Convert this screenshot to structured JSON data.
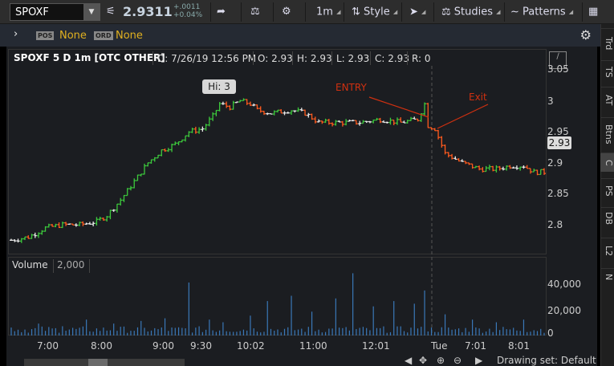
{
  "toolbar": {
    "symbol": "SPOXF",
    "last_price": "2.9311",
    "net_change": "+.0011",
    "pct_change": "+0.04%",
    "timeframe": "1m",
    "style_label": "Style",
    "studies_label": "Studies",
    "patterns_label": "Patterns"
  },
  "subbar": {
    "pos_tag": "POS",
    "pos_value": "None",
    "ord_tag": "ORD",
    "ord_value": "None"
  },
  "chart_header": {
    "symbol_desc": "SPOXF 5 D 1m [OTC OTHER]",
    "date": "D: 7/26/19 12:56 PM",
    "open": "O: 2.93",
    "high": "H: 2.93",
    "low": "L: 2.93",
    "close": "C: 2.93",
    "range": "R: 0"
  },
  "volume_header": {
    "label": "Volume",
    "value": "2,000"
  },
  "price_flag": "2.93",
  "annotations": {
    "entry": "ENTRY",
    "exit": "Exit",
    "high_bubble": "Hi: 3"
  },
  "drawing_set": "Drawing set: Default",
  "right_tabs": [
    "Trd",
    "TS",
    "AT",
    "Btns",
    "C",
    "PS",
    "DB",
    "L2",
    "N"
  ],
  "colors": {
    "up": "#3cc83c",
    "down": "#ff5a1e",
    "neutral": "#e8e8e8",
    "volume": "#3a78b8",
    "annotation": "#d03010",
    "symbol_text": "#e0b020"
  },
  "chart_data": {
    "type": "bar",
    "title": "SPOXF 5 D 1m [OTC OTHER]",
    "x_tick_labels": [
      "7:00",
      "8:00",
      "9:00",
      "9:30",
      "10:02",
      "11:00",
      "12:01",
      "Tue",
      "7:01",
      "8:01"
    ],
    "price_axis": {
      "ticks": [
        "3.05",
        "3",
        "2.95",
        "2.9",
        "2.85",
        "2.8"
      ],
      "ylim": [
        2.77,
        3.06
      ]
    },
    "volume_axis": {
      "ticks": [
        "40,000",
        "20,000",
        "0"
      ],
      "ylim": [
        0,
        48000
      ]
    },
    "price_path": [
      [
        0,
        2.775
      ],
      [
        5,
        2.78
      ],
      [
        10,
        2.795
      ],
      [
        15,
        2.8
      ],
      [
        20,
        2.8
      ],
      [
        25,
        2.805
      ],
      [
        28,
        2.815
      ],
      [
        32,
        2.84
      ],
      [
        36,
        2.87
      ],
      [
        40,
        2.9
      ],
      [
        44,
        2.92
      ],
      [
        48,
        2.93
      ],
      [
        52,
        2.95
      ],
      [
        56,
        2.955
      ],
      [
        59,
        2.975
      ],
      [
        61,
        2.995
      ],
      [
        64,
        2.99
      ],
      [
        67,
        3.0
      ],
      [
        70,
        2.995
      ],
      [
        72,
        2.985
      ],
      [
        76,
        2.98
      ],
      [
        82,
        2.985
      ],
      [
        86,
        2.98
      ],
      [
        90,
        2.965
      ],
      [
        96,
        2.965
      ],
      [
        102,
        2.965
      ],
      [
        108,
        2.97
      ],
      [
        114,
        2.965
      ],
      [
        119,
        2.97
      ],
      [
        121,
        2.995
      ],
      [
        122,
        2.96
      ],
      [
        124,
        2.955
      ],
      [
        127,
        2.915
      ],
      [
        132,
        2.9
      ],
      [
        137,
        2.89
      ],
      [
        142,
        2.89
      ],
      [
        146,
        2.895
      ],
      [
        150,
        2.895
      ],
      [
        153,
        2.885
      ],
      [
        155,
        2.885
      ]
    ],
    "volume_spikes": [
      [
        0,
        6000
      ],
      [
        8,
        9000
      ],
      [
        15,
        7000
      ],
      [
        22,
        12000
      ],
      [
        30,
        9000
      ],
      [
        38,
        11000
      ],
      [
        45,
        13000
      ],
      [
        52,
        40000
      ],
      [
        58,
        12000
      ],
      [
        62,
        10000
      ],
      [
        70,
        15000
      ],
      [
        75,
        26000
      ],
      [
        82,
        30000
      ],
      [
        88,
        18000
      ],
      [
        95,
        28000
      ],
      [
        100,
        47000
      ],
      [
        106,
        22000
      ],
      [
        112,
        26000
      ],
      [
        118,
        24000
      ],
      [
        121,
        34000
      ],
      [
        127,
        16000
      ],
      [
        135,
        12000
      ],
      [
        142,
        10000
      ],
      [
        150,
        12000
      ]
    ]
  }
}
